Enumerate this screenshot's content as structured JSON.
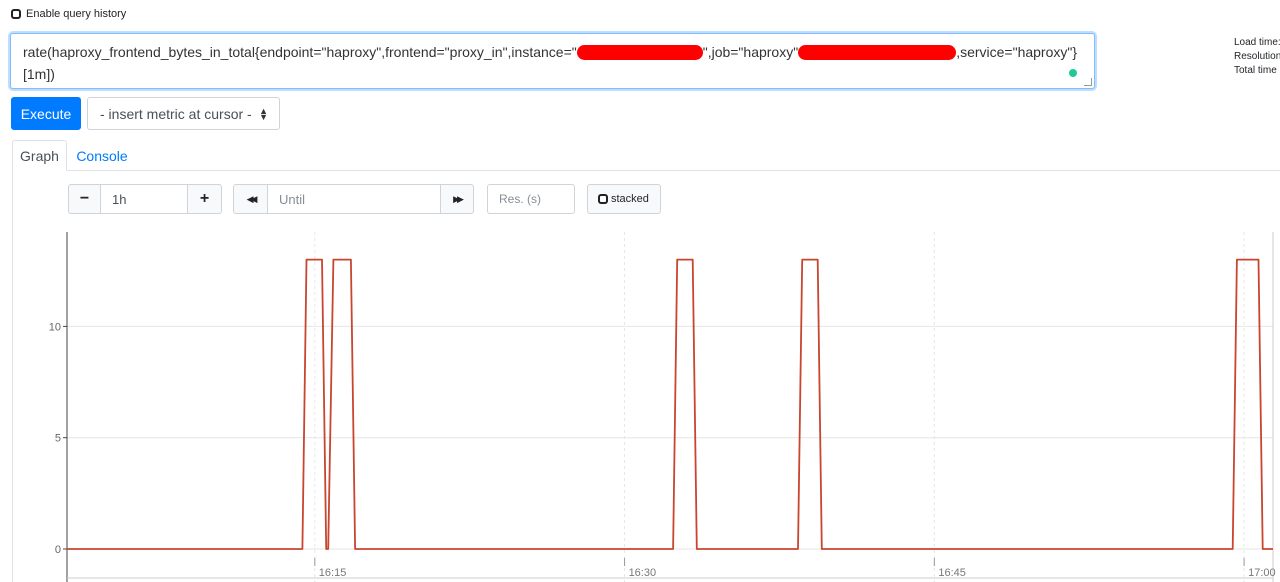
{
  "history": {
    "label": "Enable query history",
    "checked": false
  },
  "query": {
    "part1": "rate(haproxy_frontend_bytes_in_total{endpoint=\"haproxy\",frontend=\"proxy_in\",instance=\"",
    "part2": "\",job=\"haproxy\"",
    "part3": ",service=\"haproxy\"}",
    "line2": "[1m])"
  },
  "stats": {
    "load_time": "Load time:",
    "resolution": "Resolution:",
    "total_time": "Total time s"
  },
  "buttons": {
    "execute": "Execute",
    "insert_metric": "- insert metric at cursor -"
  },
  "tabs": [
    {
      "label": "Graph",
      "active": true
    },
    {
      "label": "Console",
      "active": false
    }
  ],
  "controls": {
    "minus": "−",
    "range": "1h",
    "plus": "+",
    "back": "◀◀",
    "until_placeholder": "Until",
    "forward": "▶▶",
    "res_placeholder": "Res. (s)",
    "stacked": "stacked"
  },
  "colors": {
    "accent": "#007bff",
    "series": "#c8452f",
    "status_ok": "#20c997",
    "redaction": "#ff0000"
  },
  "chart_data": {
    "type": "line",
    "y_ticks": [
      "0",
      "5",
      "10"
    ],
    "ylim": [
      0,
      14
    ],
    "x_ticks": [
      "16:15",
      "16:30",
      "16:45",
      "17:00"
    ],
    "x_tick_minutes": [
      15,
      30,
      45,
      60
    ],
    "xlim_minutes": [
      3,
      61.4
    ],
    "grid": true,
    "series": [
      {
        "x": [
          3,
          14.4,
          14.6,
          15.35,
          15.55,
          15.65,
          15.9,
          16.0,
          16.75,
          16.95,
          32.35,
          32.55,
          33.3,
          33.5,
          38.4,
          38.6,
          39.35,
          39.55,
          59.45,
          59.65,
          60.0,
          60.4,
          60.7,
          60.9,
          61.4
        ],
        "y": [
          0,
          0,
          13,
          13,
          0,
          0,
          13,
          13,
          13,
          0,
          0,
          13,
          13,
          0,
          0,
          13,
          13,
          0,
          0,
          13,
          13,
          13,
          13,
          0,
          0
        ]
      }
    ]
  }
}
